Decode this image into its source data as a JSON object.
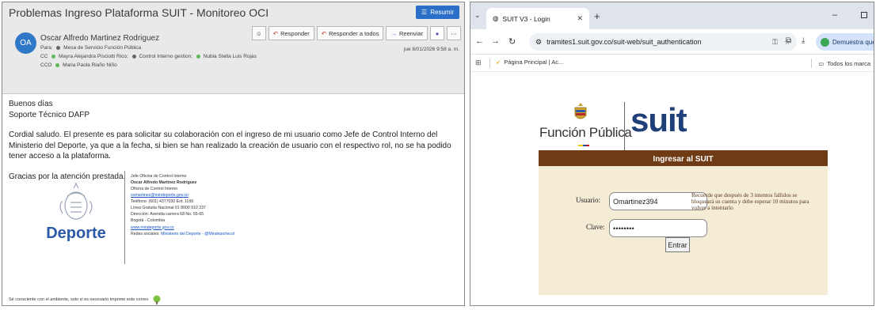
{
  "email": {
    "subject": "Problemas Ingreso Plataforma SUIT - Monitoreo OCI",
    "summarize_label": "Resumir",
    "avatar_initials": "OA",
    "sender": "Oscar Alfredo Martinez Rodriguez",
    "to_label": "Para:",
    "to": "Mesa de Servicio Función Pública",
    "cc_label": "CC",
    "cc_1": "Mayra Alejandra Pisciotti Rico;",
    "cc_2": "Control Interno gestion;",
    "cc_3": "Nubia Stella Luis Rojas",
    "bcc_label": "CCO",
    "bcc": "Maria Paola Riaño Niño",
    "reply_label": "Responder",
    "reply_all_label": "Responder a todos",
    "forward_label": "Reenviar",
    "date": "jue 8/01/2026 9:58 a. m.",
    "greeting": "Buenos días",
    "recipient_team": "Soporte Técnico DAFP",
    "body": "Cordial saludo. El presente es para solicitar su colaboración con el ingreso de mi usuario como Jefe de Control Interno del Ministerio del Deporte, ya que a la fecha, si bien se han realizado la creación de usuario con el respectivo rol, no se ha podido tener acceso a la plataforma.",
    "thanks": "Gracias por la atención prestada.",
    "signature": {
      "logo_word": "Deporte",
      "role": "Jefe Oficina de Control Interno",
      "name": "Oscar Alfredo Martinez Rodriguez",
      "office": "Oficina de Control Interno",
      "email": "osmartinez@mindeporte.gov.co",
      "phone": "Teléfono: (601) 4377030 Ext. 1190",
      "toll_free": "Línea Gratuita Nacional 01 8000 910 237",
      "address": "Dirección: Avenida carrera 68 No. 55-65",
      "city": "Bogotá - Colombia",
      "website": "www.mindeporte.gov.co",
      "social_label": "Redes sociales:",
      "social": "Ministerio del Deporte - @Mindeportecol"
    },
    "eco_note": "Sé consciente con el ambiente, solo si es necesario imprime este correo"
  },
  "browser": {
    "tab_title": "SUIT V3 - Login",
    "url": "tramites1.suit.gov.co/suit-web/suit_authentication",
    "profile_pill": "Demuestra que eres tú",
    "bookmark_1": "Página Principal | Ac...",
    "all_bookmarks": "Todos los marca"
  },
  "suit": {
    "org_name": "Función Pública",
    "brand": "suit",
    "panel_title": "Ingresar al SUIT",
    "user_label": "Usuario:",
    "user_value": "Omartinez394",
    "password_label": "Clave:",
    "password_mask": "••••••••",
    "notice": "Recuerde que después de 3 intentos fallidos se bloqueará su cuenta y debe esperar 10 minutos para volver a intentarlo",
    "submit_label": "Entrar"
  },
  "colors": {
    "outlook_accent": "#2b6fc9",
    "suit_brown": "#6e3b15",
    "suit_panel": "#f5ecd6",
    "suit_blue": "#1f3f78"
  }
}
